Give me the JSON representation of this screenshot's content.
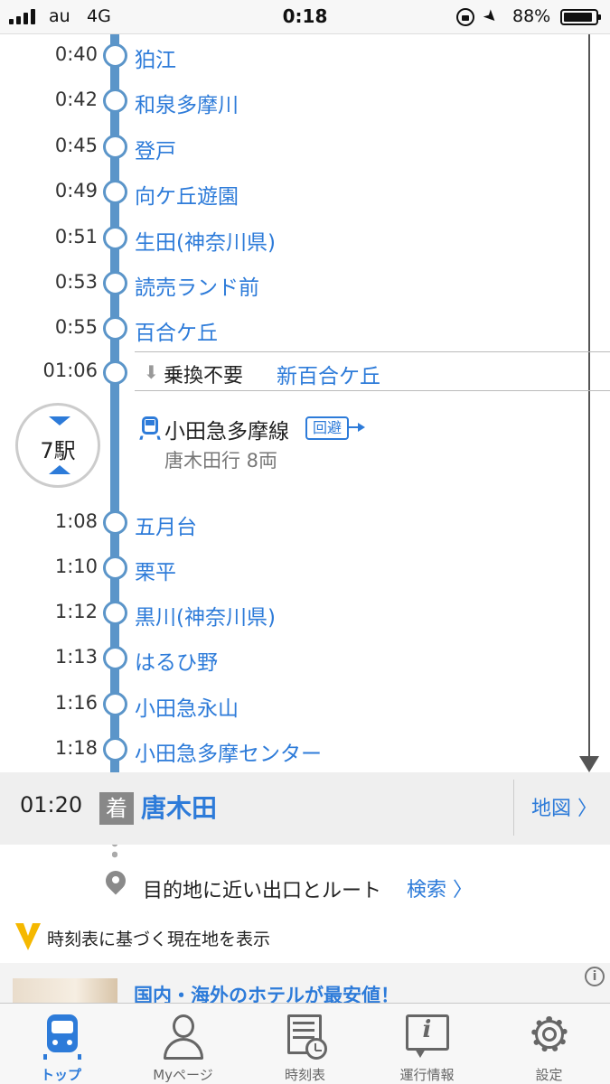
{
  "status_bar": {
    "carrier": "au",
    "network": "4G",
    "time": "0:18",
    "battery": "88%",
    "battery_level": 0.88
  },
  "stops_before": [
    {
      "time": "0:40",
      "name": "狛江"
    },
    {
      "time": "0:42",
      "name": "和泉多摩川"
    },
    {
      "time": "0:45",
      "name": "登戸"
    },
    {
      "time": "0:49",
      "name": "向ケ丘遊園"
    },
    {
      "time": "0:51",
      "name": "生田(神奈川県)"
    },
    {
      "time": "0:53",
      "name": "読売ランド前"
    },
    {
      "time": "0:55",
      "name": "百合ケ丘"
    }
  ],
  "transfer": {
    "time": "01:06",
    "label": "乗換不要",
    "station": "新百合ケ丘"
  },
  "segment": {
    "station_count": "7駅",
    "line_name": "小田急多摩線",
    "avoid_label": "回避",
    "destination": "唐木田行 8両"
  },
  "stops_after": [
    {
      "time": "1:08",
      "name": "五月台"
    },
    {
      "time": "1:10",
      "name": "栗平"
    },
    {
      "time": "1:12",
      "name": "黒川(神奈川県)"
    },
    {
      "time": "1:13",
      "name": "はるひ野"
    },
    {
      "time": "1:16",
      "name": "小田急永山"
    },
    {
      "time": "1:18",
      "name": "小田急多摩センター"
    }
  ],
  "arrival": {
    "time": "01:20",
    "badge": "着",
    "station": "唐木田",
    "map_label": "地図 〉"
  },
  "exit_route": {
    "label": "目的地に近い出口とルート",
    "search_label": "検索 〉"
  },
  "position_toggle": {
    "label": "時刻表に基づく現在地を表示"
  },
  "ad": {
    "text": "国内・海外のホテルが最安値！"
  },
  "tabs": [
    {
      "label": "トップ",
      "icon": "train-icon",
      "active": true
    },
    {
      "label": "Myページ",
      "icon": "user-icon",
      "active": false
    },
    {
      "label": "時刻表",
      "icon": "timetable-icon",
      "active": false
    },
    {
      "label": "運行情報",
      "icon": "info-icon",
      "active": false
    },
    {
      "label": "設定",
      "icon": "gear-icon",
      "active": false
    }
  ],
  "colors": {
    "accent": "#2d7bd9",
    "rail": "#5b95c9",
    "position_icon": "#f5b800"
  }
}
